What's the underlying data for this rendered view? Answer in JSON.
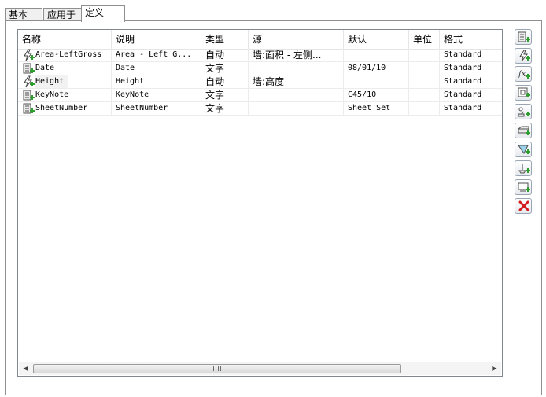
{
  "tabs": [
    {
      "label": "基本"
    },
    {
      "label": "应用于"
    },
    {
      "label": "定义",
      "active": true
    }
  ],
  "table": {
    "columns": [
      "名称",
      "说明",
      "类型",
      "源",
      "默认",
      "单位",
      "格式"
    ],
    "rows": [
      {
        "icon": "lightning-add-icon",
        "name": "Area-LeftGross",
        "description": "Area - Left G...",
        "type": "自动",
        "source": "墙:面积 - 左侧...",
        "default": "",
        "unit": "",
        "format": "Standard"
      },
      {
        "icon": "text-property-icon",
        "name": "Date",
        "description": "Date",
        "type": "文字",
        "source": "",
        "default": "08/01/10",
        "unit": "",
        "format": "Standard"
      },
      {
        "icon": "lightning-add-icon",
        "name": "Height",
        "description": "Height",
        "type": "自动",
        "source": "墙:高度",
        "default": "",
        "unit": "",
        "format": "Standard",
        "selected": true
      },
      {
        "icon": "text-property-icon",
        "name": "KeyNote",
        "description": "KeyNote",
        "type": "文字",
        "source": "",
        "default": "C45/10",
        "unit": "",
        "format": "Standard"
      },
      {
        "icon": "text-property-icon",
        "name": "SheetNumber",
        "description": "SheetNumber",
        "type": "文字",
        "source": "",
        "default": "Sheet Set",
        "unit": "",
        "format": "Standard"
      }
    ]
  },
  "scrollbar": {
    "left_arrow": "◀",
    "right_arrow": "▶"
  },
  "toolbar": [
    {
      "icon": "add-text-property-icon"
    },
    {
      "icon": "add-automatic-property-icon"
    },
    {
      "icon": "add-formula-property-icon"
    },
    {
      "icon": "add-anchor-property-icon"
    },
    {
      "icon": "add-graphic-property-icon"
    },
    {
      "icon": "add-material-property-icon"
    },
    {
      "icon": "add-classification-property-icon"
    },
    {
      "icon": "add-location-property-icon"
    },
    {
      "icon": "add-reference-property-icon"
    },
    {
      "icon": "delete-icon"
    }
  ]
}
